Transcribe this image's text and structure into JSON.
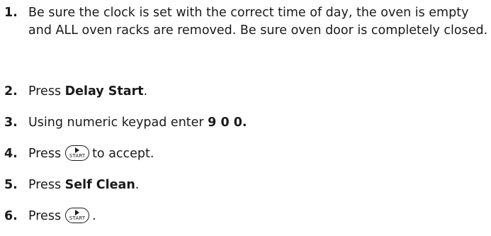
{
  "steps": [
    {
      "number": "1.",
      "text": "Be sure the clock is set with the correct time of day, the oven is empty and ALL oven racks are removed. Be sure oven door is completely closed."
    },
    {
      "number": "2.",
      "prefix": "Press ",
      "bold": "Delay Start",
      "suffix": "."
    },
    {
      "number": "3.",
      "prefix": "Using numeric keypad enter ",
      "bold": "9 0 0."
    },
    {
      "number": "4.",
      "prefix": "Press",
      "suffix": "to accept."
    },
    {
      "number": "5.",
      "prefix": "Press ",
      "bold": "Self Clean",
      "suffix": "."
    },
    {
      "number": "6.",
      "prefix": "Press",
      "suffix": "."
    }
  ],
  "start_key": {
    "label": "START",
    "icon": "play-triangle-icon"
  }
}
